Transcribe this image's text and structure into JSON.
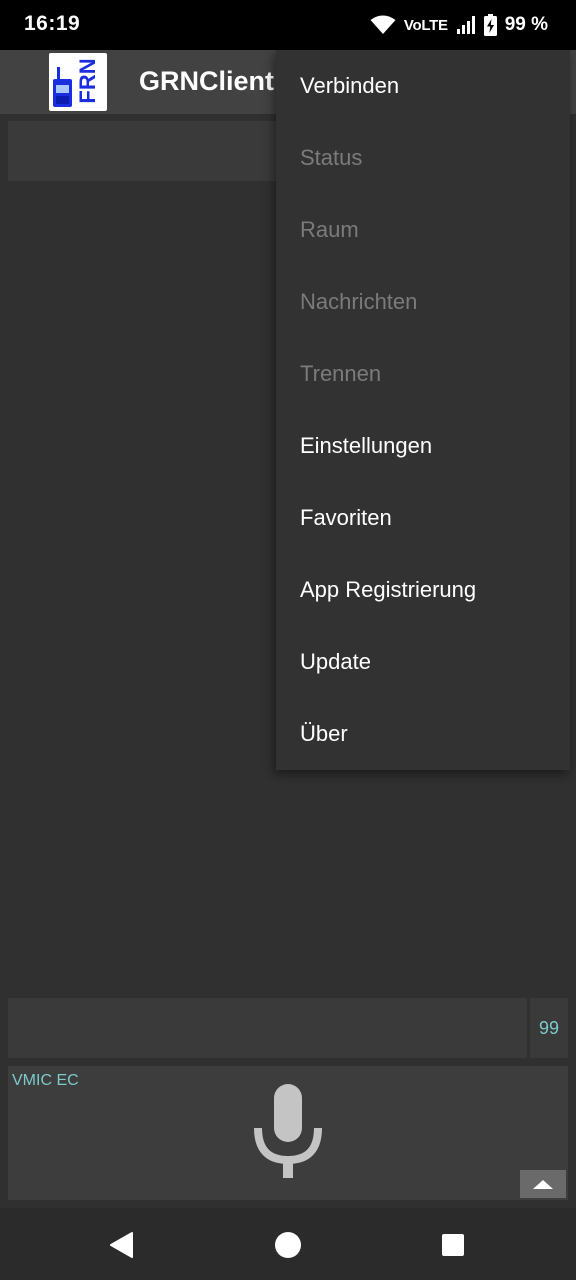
{
  "status_bar": {
    "time": "16:19",
    "network": "VoLTE",
    "battery": "99 %"
  },
  "app_bar": {
    "title": "GRNClient",
    "logo_text": "FRN"
  },
  "menu": {
    "items": [
      {
        "label": "Verbinden",
        "enabled": true
      },
      {
        "label": "Status",
        "enabled": false
      },
      {
        "label": "Raum",
        "enabled": false
      },
      {
        "label": "Nachrichten",
        "enabled": false
      },
      {
        "label": "Trennen",
        "enabled": false
      },
      {
        "label": "Einstellungen",
        "enabled": true
      },
      {
        "label": "Favoriten",
        "enabled": true
      },
      {
        "label": "App Registrierung",
        "enabled": true
      },
      {
        "label": "Update",
        "enabled": true
      },
      {
        "label": "Über",
        "enabled": true
      }
    ]
  },
  "input": {
    "message_value": "",
    "count": "99"
  },
  "ptt": {
    "mic_mode": "VMIC EC"
  },
  "colors": {
    "accent_text": "#7ec9c9",
    "menu_bg": "#323232",
    "app_bar": "#424242"
  }
}
